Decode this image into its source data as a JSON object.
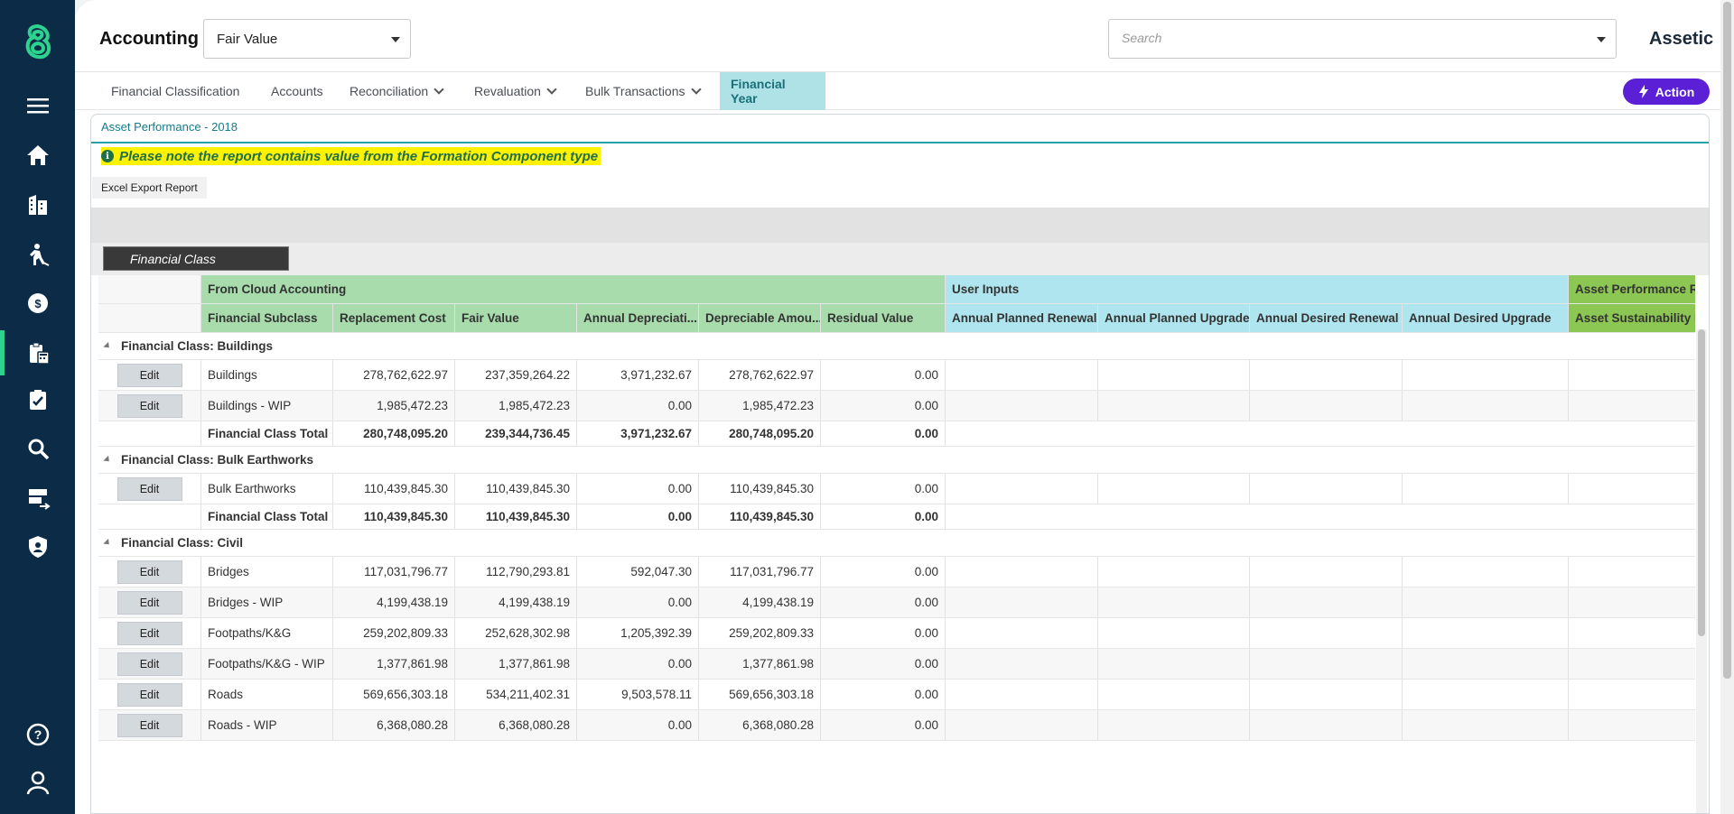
{
  "app": {
    "title": "Accounting",
    "brand": "Assetic"
  },
  "module_select": {
    "value": "Fair Value"
  },
  "search": {
    "placeholder": "Search"
  },
  "sidebar": {
    "icons": [
      "logo-icon",
      "menu-icon",
      "home-icon",
      "buildings-icon",
      "worker-icon",
      "finance-icon",
      "accounting-icon",
      "assessment-icon",
      "search-icon",
      "data-exchange-icon",
      "security-icon",
      "help-icon",
      "user-icon"
    ],
    "active": "accounting-icon",
    "accent": "#2ed28f",
    "bg": "#0b2b47"
  },
  "nav": {
    "items": [
      {
        "label": "Financial Classification"
      },
      {
        "label": "Accounts"
      },
      {
        "label": "Reconciliation"
      },
      {
        "label": "Revaluation"
      },
      {
        "label": "Bulk Transactions"
      },
      {
        "label": "Financial Year"
      }
    ],
    "active": "Financial Year",
    "action_label": "Action"
  },
  "report": {
    "title": "Asset Performance - 2018",
    "note": "Please note the report contains value from the Formation Component type",
    "export_label": "Excel Export Report",
    "group_chip": "Financial Class"
  },
  "grid": {
    "header_groups": [
      "From Cloud Accounting",
      "User Inputs",
      "Asset Performance Ratios"
    ],
    "columns": [
      "Financial Subclass",
      "Replacement Cost",
      "Fair Value",
      "Annual Depreciati...",
      "Depreciable Amou...",
      "Residual Value",
      "Annual Planned Renewal",
      "Annual Planned Upgrade",
      "Annual Desired Renewal",
      "Annual Desired Upgrade",
      "Asset Sustainability Rat..."
    ],
    "edit_label": "Edit",
    "groups": [
      {
        "label": "Financial Class: Buildings",
        "rows": [
          [
            "Buildings",
            "278,762,622.97",
            "237,359,264.22",
            "3,971,232.67",
            "278,762,622.97",
            "0.00"
          ],
          [
            "Buildings - WIP",
            "1,985,472.23",
            "1,985,472.23",
            "0.00",
            "1,985,472.23",
            "0.00"
          ]
        ],
        "total": [
          "Financial Class Total",
          "280,748,095.20",
          "239,344,736.45",
          "3,971,232.67",
          "280,748,095.20",
          "0.00"
        ]
      },
      {
        "label": "Financial Class: Bulk Earthworks",
        "rows": [
          [
            "Bulk Earthworks",
            "110,439,845.30",
            "110,439,845.30",
            "0.00",
            "110,439,845.30",
            "0.00"
          ]
        ],
        "total": [
          "Financial Class Total",
          "110,439,845.30",
          "110,439,845.30",
          "0.00",
          "110,439,845.30",
          "0.00"
        ]
      },
      {
        "label": "Financial Class: Civil",
        "rows": [
          [
            "Bridges",
            "117,031,796.77",
            "112,790,293.81",
            "592,047.30",
            "117,031,796.77",
            "0.00"
          ],
          [
            "Bridges - WIP",
            "4,199,438.19",
            "4,199,438.19",
            "0.00",
            "4,199,438.19",
            "0.00"
          ],
          [
            "Footpaths/K&G",
            "259,202,809.33",
            "252,628,302.98",
            "1,205,392.39",
            "259,202,809.33",
            "0.00"
          ],
          [
            "Footpaths/K&G - WIP",
            "1,377,861.98",
            "1,377,861.98",
            "0.00",
            "1,377,861.98",
            "0.00"
          ],
          [
            "Roads",
            "569,656,303.18",
            "534,211,402.31",
            "9,503,578.11",
            "569,656,303.18",
            "0.00"
          ],
          [
            "Roads - WIP",
            "6,368,080.28",
            "6,368,080.28",
            "0.00",
            "6,368,080.28",
            "0.00"
          ]
        ]
      }
    ]
  }
}
